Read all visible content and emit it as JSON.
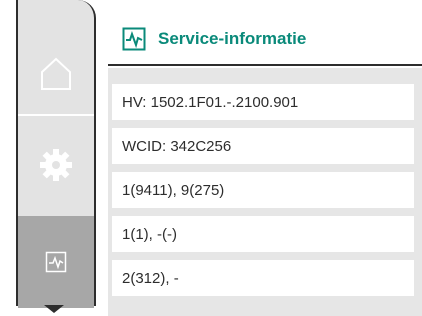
{
  "header": {
    "title": "Service-informatie",
    "icon": "activity-icon",
    "accent_color": "#0a8a7a"
  },
  "nav": {
    "items": [
      {
        "name": "home",
        "icon": "home-icon",
        "active": false
      },
      {
        "name": "settings",
        "icon": "gear-icon",
        "active": false
      },
      {
        "name": "service",
        "icon": "activity-icon",
        "active": true
      }
    ],
    "scroll_icon": "chevron-down-icon"
  },
  "info_rows": [
    {
      "text": "HV: 1502.1F01.-.2100.901"
    },
    {
      "text": "WCID: 342C256"
    },
    {
      "text": "1(9411), 9(275)"
    },
    {
      "text": "1(1), -(-)"
    },
    {
      "text": "2(312), -"
    }
  ]
}
